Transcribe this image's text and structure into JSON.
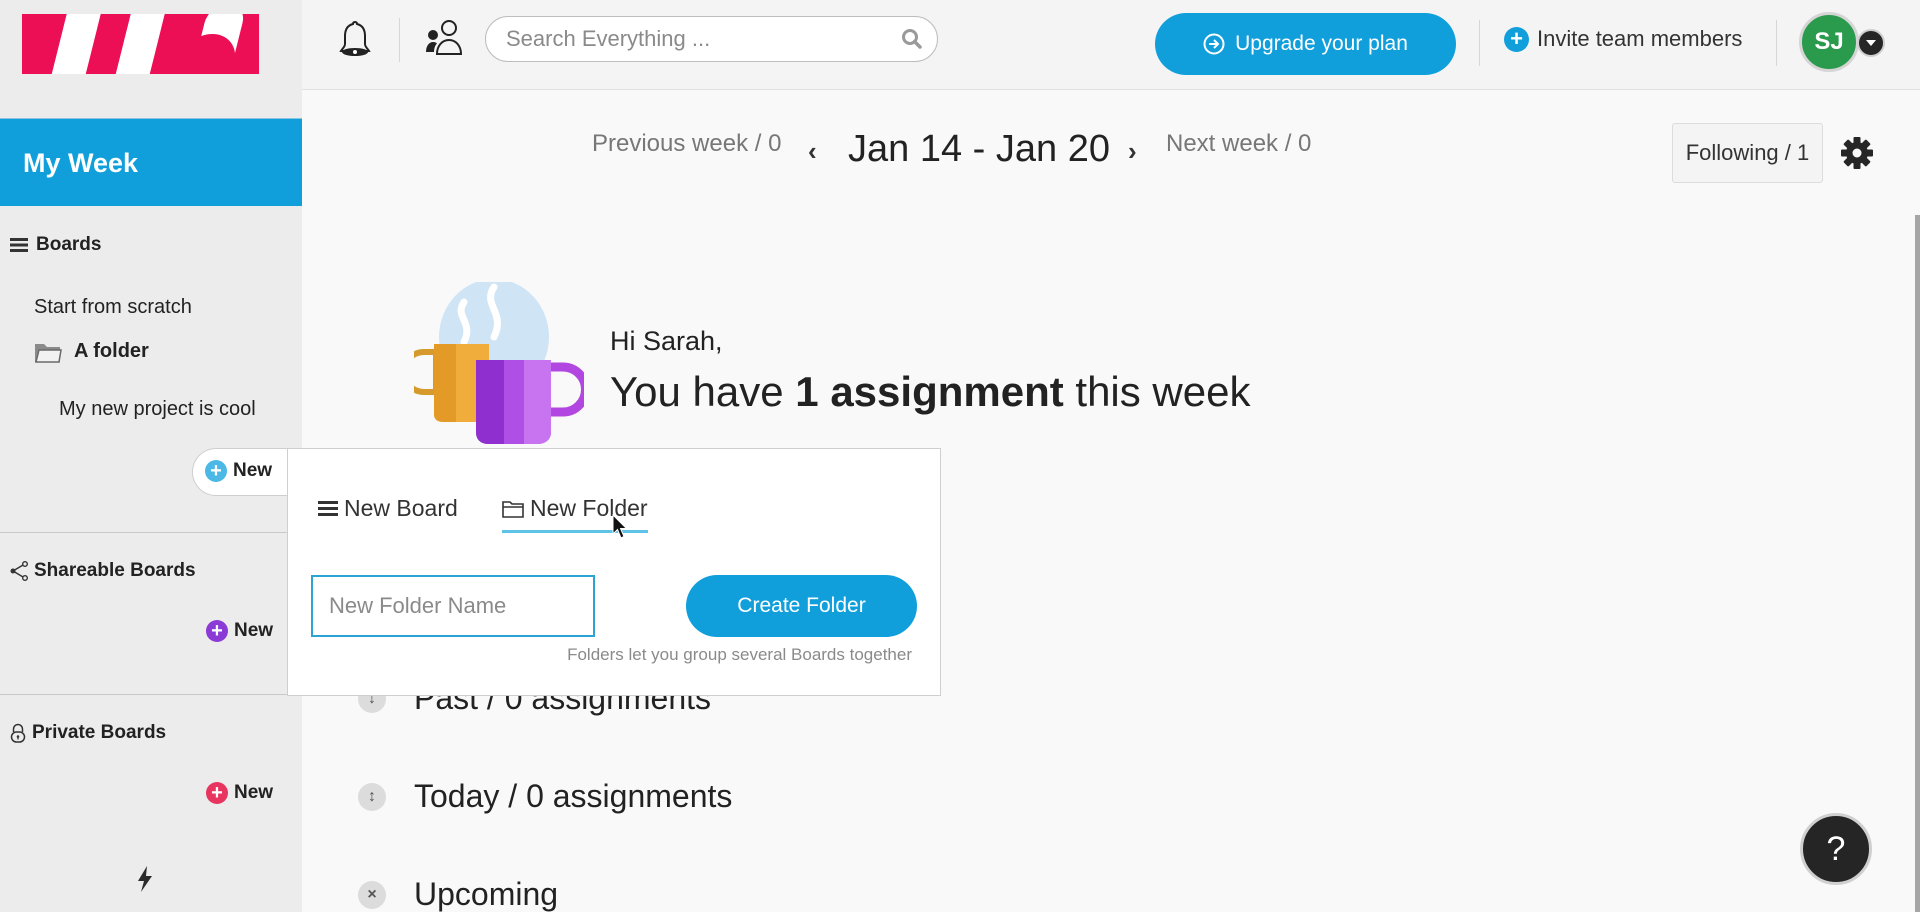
{
  "brand": {
    "accent": "#119fdb",
    "logo_color": "#ec0f56"
  },
  "sidebar": {
    "my_week_label": "My Week",
    "boards": {
      "heading": "Boards",
      "items": [
        {
          "label": "Start from scratch",
          "type": "board"
        },
        {
          "label": "A folder",
          "type": "folder"
        },
        {
          "label": "My new project is cool",
          "type": "board-in-folder"
        }
      ],
      "new_label": "New",
      "new_color": "#4cb8e6"
    },
    "shareable": {
      "heading": "Shareable Boards",
      "new_label": "New",
      "new_color": "#8b3ad6"
    },
    "private": {
      "heading": "Private Boards",
      "new_label": "New",
      "new_color": "#e8355f"
    }
  },
  "topbar": {
    "search_placeholder": "Search Everything ...",
    "upgrade_label": "Upgrade your plan",
    "invite_label": "Invite team members",
    "avatar_initials": "SJ",
    "avatar_color": "#2a9a4d"
  },
  "week": {
    "previous_label": "Previous week / 0",
    "range": "Jan 14 - Jan 20",
    "next_label": "Next week / 0",
    "following_label": "Following / 1"
  },
  "greeting": {
    "hi": "Hi Sarah,",
    "prefix": "You have ",
    "count_bold": "1 assignment",
    "suffix": " this week"
  },
  "sections": [
    {
      "label": "Past / 0 assignments",
      "icon": "arrow-down"
    },
    {
      "label": "Today  / 0 assignments",
      "icon": "arrow-up-down"
    },
    {
      "label": "Upcoming",
      "icon": "chevrons"
    }
  ],
  "popup": {
    "tab_board": "New Board",
    "tab_folder": "New Folder",
    "active_tab": "New Folder",
    "input_placeholder": "New Folder Name",
    "input_value": "",
    "create_label": "Create Folder",
    "hint": "Folders let you group several Boards together"
  },
  "help_label": "?"
}
